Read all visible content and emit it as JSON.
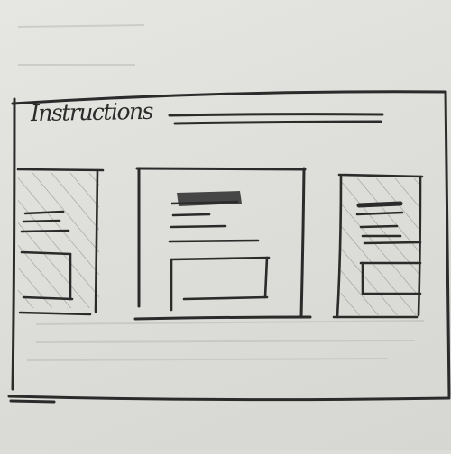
{
  "sketch": {
    "title": "Instructions",
    "colors": {
      "paper": "#e2e2de",
      "ink": "#2b2b2b",
      "hatch": "#8a8a88"
    }
  }
}
